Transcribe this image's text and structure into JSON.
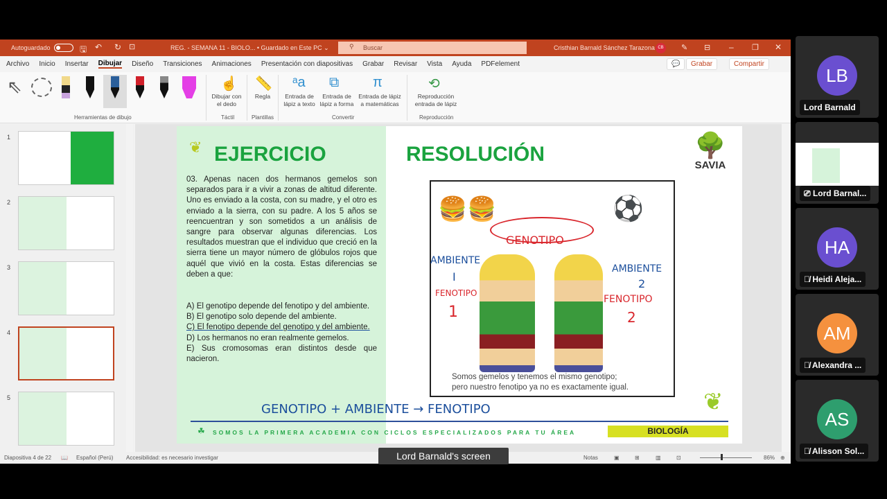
{
  "titlebar": {
    "autosave": "Autoguardado",
    "doc": "REG. - SEMANA 11 - BIOLO... • Guardado en Este PC ⌄",
    "search": "Buscar",
    "user": "Cristhian Barnald Sánchez Tarazona",
    "user_initials": "CB"
  },
  "tabs": [
    "Archivo",
    "Inicio",
    "Insertar",
    "Dibujar",
    "Diseño",
    "Transiciones",
    "Animaciones",
    "Presentación con diapositivas",
    "Grabar",
    "Revisar",
    "Vista",
    "Ayuda",
    "PDFelement"
  ],
  "tab_buttons": {
    "record": "Grabar",
    "share": "Compartir"
  },
  "ribbon": {
    "finger": "Dibujar con el dedo",
    "ruler": "Regla",
    "ink_text": "Entrada de lápiz a texto",
    "ink_shape": "Entrada de lápiz a forma",
    "ink_math": "Entrada de lápiz a matemáticas",
    "replay": "Reproducción entrada de lápiz",
    "groups": {
      "tools": "Herramientas de dibujo",
      "touch": "Táctil",
      "stencils": "Plantillas",
      "convert": "Convertir",
      "replay": "Reproducción"
    }
  },
  "thumbnails": [
    "1",
    "2",
    "3",
    "4",
    "5"
  ],
  "slide": {
    "title_left": "EJERCICIO",
    "title_right": "RESOLUCIÓN",
    "logo": "SAVIA",
    "question": "03. Apenas nacen dos hermanos gemelos son separados para ir a vivir a zonas de altitud diferente. Uno es enviado a la costa, con su madre, y el otro es enviado a la sierra, con su padre. A los 5 años se reencuentran y son sometidos a un análisis de sangre para observar algunas diferencias. Los resultados muestran que el individuo que creció en la sierra tiene un mayor número de glóbulos rojos que aquél que vivió en la costa. Estas diferencias se deben a que:",
    "options": [
      "A) El genotipo depende del fenotipo y del ambiente.",
      "B) El genotipo solo depende del ambiente.",
      "C) El fenotipo depende del genotipo y del ambiente.",
      "D) Los hermanos no eran realmente gemelos.",
      "E) Sus cromosomas eran distintos desde que nacieron."
    ],
    "caption": [
      "Somos gemelos y  tenemos el mismo genotipo;",
      "pero nuestro fenotipo ya no es exactamente igual."
    ],
    "ink": {
      "genotipo": "GENOTIPO",
      "amb1": "AMBIENTE",
      "i": "I",
      "fen1": "FENOTIPO",
      "n1": "1",
      "amb2": "AMBIENTE",
      "n2a": "2",
      "fen2": "FENOTIPO",
      "n2": "2",
      "formula": "GENOTIPO + AMBIENTE → FENOTIPO"
    },
    "footer": "SOMOS LA PRIMERA ACADEMIA CON CICLOS ESPECIALIZADOS PARA TU ÁREA",
    "subject": "BIOLOGÍA"
  },
  "status": {
    "slide": "Diapositiva 4 de 22",
    "lang": "Español (Perú)",
    "access": "Accesibilidad: es necesario investigar",
    "notes": "Notas",
    "zoom": "86%"
  },
  "share_label": "Lord Barnald's screen",
  "participants": [
    {
      "initials": "LB",
      "name": "Lord Barnald",
      "color": "#6a4fd0"
    },
    {
      "initials": "",
      "name": "Lord Barnal...",
      "color": ""
    },
    {
      "initials": "HA",
      "name": "Heidi Aleja...",
      "color": "#6a4fd0"
    },
    {
      "initials": "AM",
      "name": "Alexandra ...",
      "color": "#f5913e"
    },
    {
      "initials": "AS",
      "name": "Alisson Sol...",
      "color": "#2e9e6e"
    }
  ]
}
